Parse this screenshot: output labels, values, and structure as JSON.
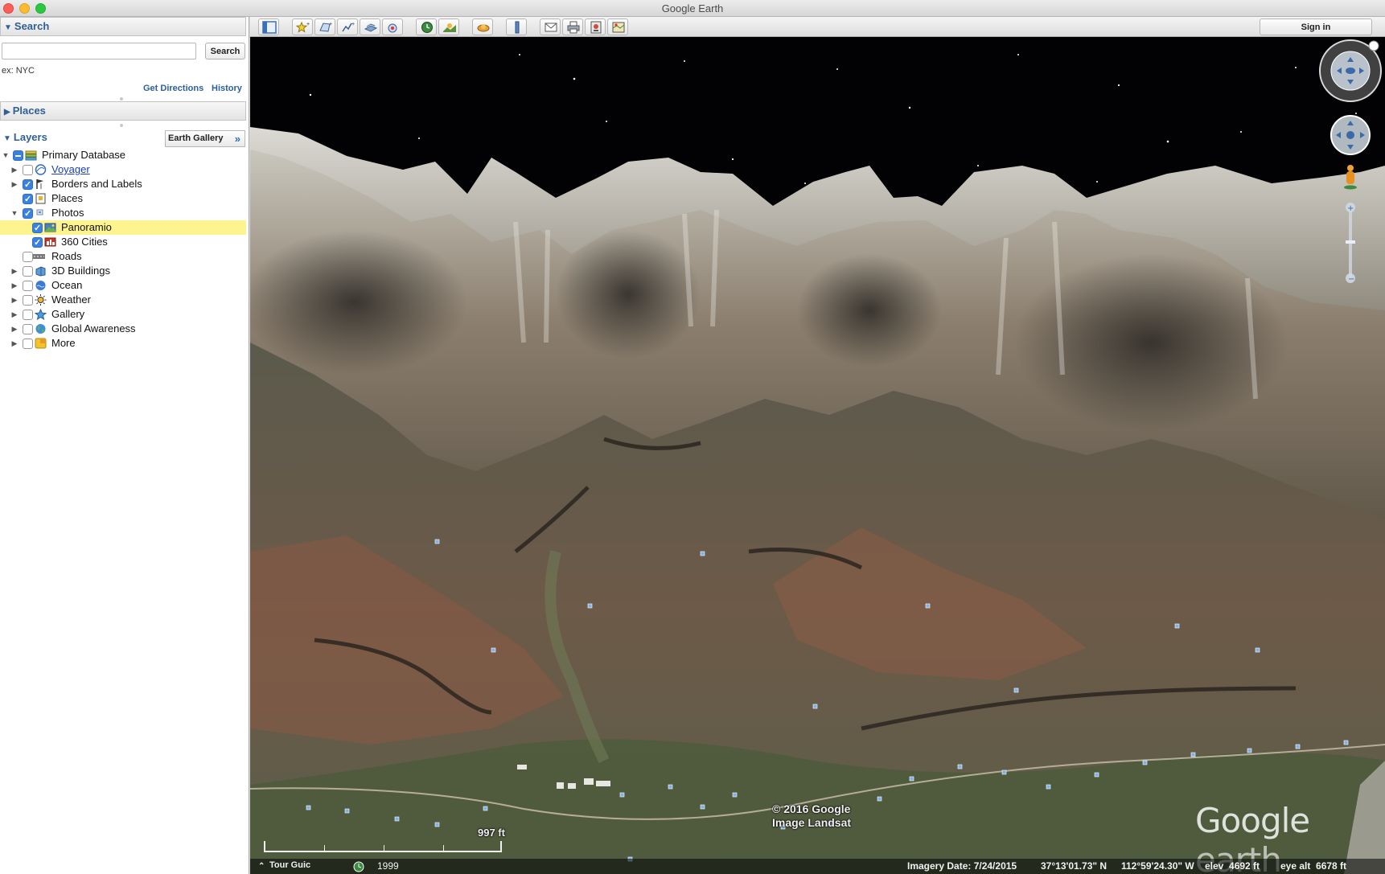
{
  "window": {
    "title": "Google Earth"
  },
  "search": {
    "header": "Search",
    "placeholder": "",
    "button_label": "Search",
    "hint": "ex: NYC",
    "get_directions": "Get Directions",
    "history": "History"
  },
  "places": {
    "header": "Places"
  },
  "layers": {
    "header": "Layers",
    "gallery_button": "Earth Gallery",
    "gallery_chevron": "»",
    "items": [
      {
        "label": "Primary Database",
        "state": "partial",
        "expanded": true,
        "icon": "database-icon"
      },
      {
        "label": "Voyager",
        "state": "off",
        "expanded": false,
        "icon": "voyager-icon",
        "link": true
      },
      {
        "label": "Borders and Labels",
        "state": "on",
        "expanded": false,
        "icon": "flag-icon"
      },
      {
        "label": "Places",
        "state": "on",
        "expanded": false,
        "icon": "places-icon"
      },
      {
        "label": "Photos",
        "state": "on",
        "expanded": true,
        "icon": "photos-icon"
      },
      {
        "label": "Panoramio",
        "state": "on",
        "icon": "panoramio-icon",
        "selected": true
      },
      {
        "label": "360 Cities",
        "state": "on",
        "icon": "360-cities-icon"
      },
      {
        "label": "Roads",
        "state": "off",
        "icon": "roads-icon"
      },
      {
        "label": "3D Buildings",
        "state": "off",
        "expanded": false,
        "icon": "buildings-icon"
      },
      {
        "label": "Ocean",
        "state": "off",
        "expanded": false,
        "icon": "ocean-icon"
      },
      {
        "label": "Weather",
        "state": "off",
        "expanded": false,
        "icon": "weather-icon"
      },
      {
        "label": "Gallery",
        "state": "off",
        "expanded": false,
        "icon": "gallery-icon"
      },
      {
        "label": "Global Awareness",
        "state": "off",
        "expanded": false,
        "icon": "globe-icon"
      },
      {
        "label": "More",
        "state": "off",
        "expanded": false,
        "icon": "more-icon"
      }
    ]
  },
  "toolbar": {
    "signin": "Sign in",
    "tools": [
      "sidebar-toggle-icon",
      "add-placemark-icon",
      "add-polygon-icon",
      "add-path-icon",
      "add-image-overlay-icon",
      "record-tour-icon",
      "historical-imagery-icon",
      "sunlight-icon",
      "switch-planet-icon",
      "ruler-icon",
      "email-icon",
      "print-icon",
      "save-image-icon",
      "view-in-maps-icon"
    ]
  },
  "view": {
    "scale_label": "997 ft",
    "copyright_line1": "© 2016 Google",
    "copyright_line2": "Image Landsat",
    "logo_main": "Google",
    "logo_thin": "earth",
    "tour_guide": "Tour Guic",
    "year": "1999",
    "imagery_date": "Imagery Date: 7/24/2015",
    "lat": "37°13'01.73\" N",
    "lon": "112°59'24.30\" W",
    "elev": "elev  4692 ft",
    "eye_alt": "eye alt  6678 ft"
  },
  "colors": {
    "sidebar_link": "#2a5fa0",
    "selection": "#fdf38f",
    "checkbox": "#3b82e0"
  }
}
